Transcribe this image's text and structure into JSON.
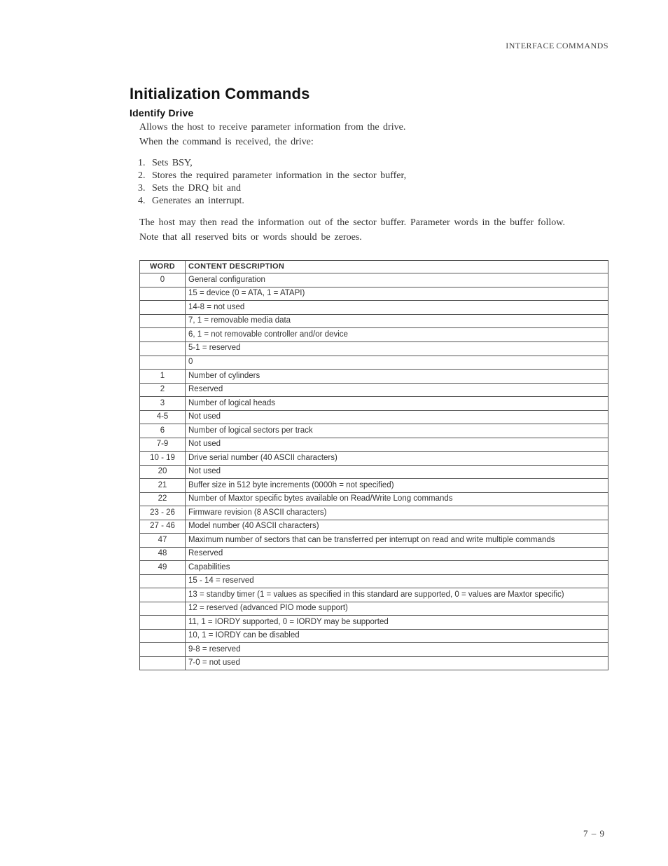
{
  "running_head": "INTERFACE COMMANDS",
  "section_title": "Initialization Commands",
  "subhead": "Identify Drive",
  "intro_lines": [
    "Allows the host to receive parameter information from the drive.",
    "When the command is received, the drive:"
  ],
  "steps": [
    "Sets BSY,",
    "Stores the required parameter information in the sector buffer,",
    "Sets the DRQ bit and",
    "Generates an interrupt."
  ],
  "after_lines": [
    "The host may then read the information out of the sector buffer. Parameter words in the buffer follow.",
    "Note that all reserved bits or words should be zeroes."
  ],
  "table": {
    "headers": {
      "word": "WORD",
      "desc": "CONTENT DESCRIPTION"
    },
    "rows": [
      {
        "word": "0",
        "desc": "General configuration"
      },
      {
        "word": "",
        "desc": "15 = device (0 = ATA, 1 = ATAPI)",
        "cont": true
      },
      {
        "word": "",
        "desc": "14-8 = not used",
        "cont": true
      },
      {
        "word": "",
        "desc": "7, 1 = removable media data",
        "cont": true
      },
      {
        "word": "",
        "desc": "6, 1 = not removable controller and/or device",
        "cont": true
      },
      {
        "word": "",
        "desc": "5-1 = reserved",
        "cont": true
      },
      {
        "word": "",
        "desc": "0",
        "cont": true
      },
      {
        "word": "1",
        "desc": "Number of cylinders"
      },
      {
        "word": "2",
        "desc": "Reserved"
      },
      {
        "word": "3",
        "desc": "Number of logical heads"
      },
      {
        "word": "4-5",
        "desc": "Not used"
      },
      {
        "word": "6",
        "desc": "Number of logical sectors per track"
      },
      {
        "word": "7-9",
        "desc": "Not used"
      },
      {
        "word": "10 - 19",
        "desc": "Drive serial number (40 ASCII characters)"
      },
      {
        "word": "20",
        "desc": "Not used"
      },
      {
        "word": "21",
        "desc": "Buffer size in 512 byte increments (0000h = not specified)"
      },
      {
        "word": "22",
        "desc": "Number of Maxtor specific bytes available on Read/Write Long commands"
      },
      {
        "word": "23 - 26",
        "desc": "Firmware revision (8 ASCII characters)"
      },
      {
        "word": "27 - 46",
        "desc": "Model number (40 ASCII characters)"
      },
      {
        "word": "47",
        "desc": "Maximum number of sectors that can be transferred per interrupt on read and write multiple commands"
      },
      {
        "word": "48",
        "desc": "Reserved"
      },
      {
        "word": "49",
        "desc": "Capabilities"
      },
      {
        "word": "",
        "desc": "15 - 14 = reserved",
        "cont": true
      },
      {
        "word": "",
        "desc": "13 = standby timer (1 = values as specified in this standard are supported, 0 = values are Maxtor specific)",
        "cont": true
      },
      {
        "word": "",
        "desc": "12 = reserved (advanced PIO mode support)",
        "cont": true
      },
      {
        "word": "",
        "desc": "11, 1 = IORDY supported, 0 = IORDY may be supported",
        "cont": true
      },
      {
        "word": "",
        "desc": "10, 1 = IORDY can be disabled",
        "cont": true
      },
      {
        "word": "",
        "desc": "9-8 = reserved",
        "cont": true
      },
      {
        "word": "",
        "desc": "7-0 = not used",
        "cont": true
      }
    ]
  },
  "page_number": "7 – 9"
}
